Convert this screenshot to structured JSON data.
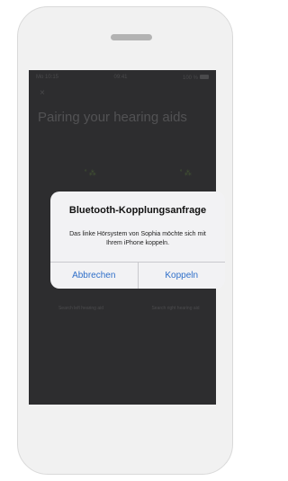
{
  "status_bar": {
    "carrier": "Mo 10:15",
    "time": "09:41",
    "battery": "100 %"
  },
  "screen": {
    "close_glyph": "×",
    "title": "Pairing your hearing aids",
    "left_aid_icon": "hearing-aid-icon",
    "right_aid_icon": "hearing-aid-icon",
    "left_caption": "Search left hearing aid",
    "right_caption": "Search right hearing aid"
  },
  "alert": {
    "title": "Bluetooth-Kopplungsanfrage",
    "message": "Das linke Hörsystem von Sophia möchte sich mit Ihrem iPhone koppeln.",
    "cancel_label": "Abbrechen",
    "confirm_label": "Koppeln"
  },
  "colors": {
    "accent": "#2f6fc9",
    "dimmed_screen": "#2d2d2f",
    "phone_frame": "#f1f1f1"
  }
}
